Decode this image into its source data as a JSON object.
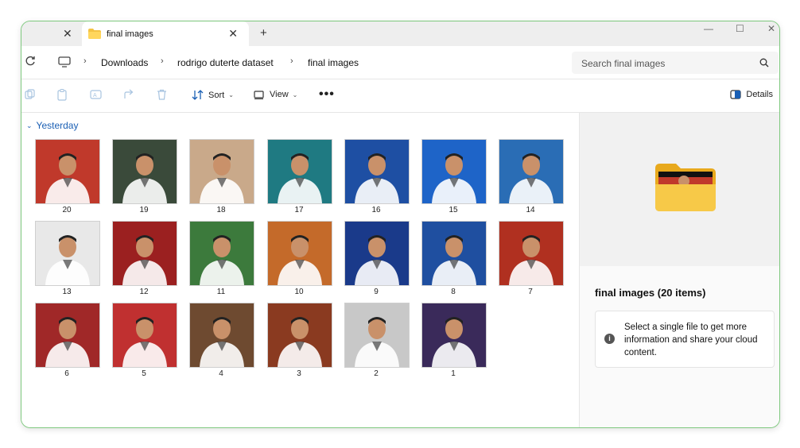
{
  "tabs": [
    {
      "label": "",
      "close": "✕"
    },
    {
      "label": "final images",
      "close": "✕"
    }
  ],
  "new_tab": "+",
  "window_controls": {
    "minimize": "—",
    "maximize": "☐",
    "close": "✕"
  },
  "nav": {
    "breadcrumbs": [
      "Downloads",
      "rodrigo duterte dataset",
      "final images"
    ],
    "separator": "›"
  },
  "search": {
    "placeholder": "Search final images"
  },
  "toolbar": {
    "sort_label": "Sort",
    "view_label": "View",
    "more_label": "•••",
    "details_label": "Details",
    "chevron": "⌄"
  },
  "group": {
    "label": "Yesterday",
    "chevron": "⌄"
  },
  "files": [
    {
      "name": "20",
      "bg": "#c0392b"
    },
    {
      "name": "19",
      "bg": "#3a4a3a"
    },
    {
      "name": "18",
      "bg": "#c9a98a"
    },
    {
      "name": "17",
      "bg": "#1f7a82"
    },
    {
      "name": "16",
      "bg": "#1e4fa3"
    },
    {
      "name": "15",
      "bg": "#1e64c8"
    },
    {
      "name": "14",
      "bg": "#2a6db5"
    },
    {
      "name": "13",
      "bg": "#e8e8e8"
    },
    {
      "name": "12",
      "bg": "#9b2020"
    },
    {
      "name": "11",
      "bg": "#3c7a3c"
    },
    {
      "name": "10",
      "bg": "#c46a2a"
    },
    {
      "name": "9",
      "bg": "#1a3a8a"
    },
    {
      "name": "8",
      "bg": "#1f4fa0"
    },
    {
      "name": "7",
      "bg": "#b03020"
    },
    {
      "name": "6",
      "bg": "#a02828"
    },
    {
      "name": "5",
      "bg": "#c03030"
    },
    {
      "name": "4",
      "bg": "#6e4a30"
    },
    {
      "name": "3",
      "bg": "#8a3a20"
    },
    {
      "name": "2",
      "bg": "#c8c8c8"
    },
    {
      "name": "1",
      "bg": "#3a2a5a"
    }
  ],
  "details_pane": {
    "title": "final images (20 items)",
    "info_text": "Select a single file to get more information and share your cloud content.",
    "info_icon": "i"
  },
  "colors": {
    "accent": "#1a5fb4",
    "folder": "#f4c343",
    "window_border": "#7fc97f"
  }
}
